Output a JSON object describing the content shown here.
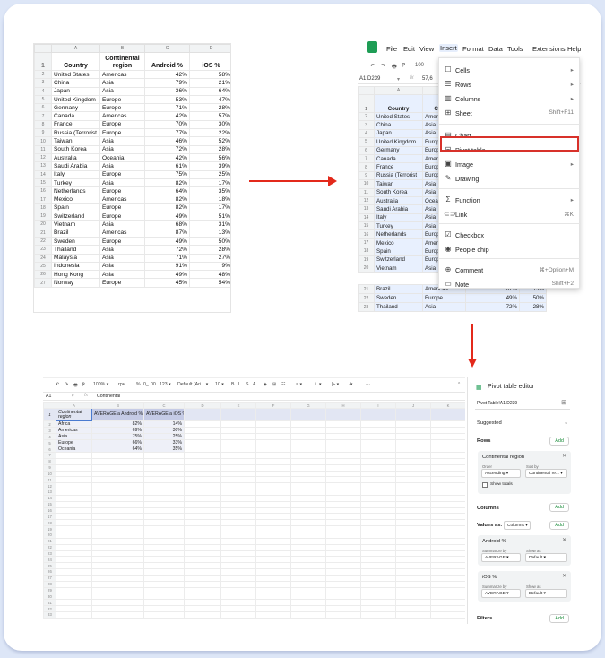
{
  "sheet1": {
    "col_letters": [
      "A",
      "B",
      "C",
      "D"
    ],
    "headers": [
      "Country",
      "Continental region",
      "Android %",
      "iOS %"
    ],
    "rows": [
      [
        "United States",
        "Americas",
        "42%",
        "58%"
      ],
      [
        "China",
        "Asia",
        "79%",
        "21%"
      ],
      [
        "Japan",
        "Asia",
        "36%",
        "64%"
      ],
      [
        "United Kingdom",
        "Europe",
        "53%",
        "47%"
      ],
      [
        "Germany",
        "Europe",
        "71%",
        "28%"
      ],
      [
        "Canada",
        "Americas",
        "42%",
        "57%"
      ],
      [
        "France",
        "Europe",
        "70%",
        "30%"
      ],
      [
        "Russia (Terrorist",
        "Europe",
        "77%",
        "22%"
      ],
      [
        "Taiwan",
        "Asia",
        "46%",
        "52%"
      ],
      [
        "South Korea",
        "Asia",
        "72%",
        "28%"
      ],
      [
        "Australia",
        "Oceania",
        "42%",
        "56%"
      ],
      [
        "Saudi Arabia",
        "Asia",
        "61%",
        "39%"
      ],
      [
        "Italy",
        "Europe",
        "75%",
        "25%"
      ],
      [
        "Turkey",
        "Asia",
        "82%",
        "17%"
      ],
      [
        "Netherlands",
        "Europe",
        "64%",
        "35%"
      ],
      [
        "Mexico",
        "Americas",
        "82%",
        "18%"
      ],
      [
        "Spain",
        "Europe",
        "82%",
        "17%"
      ],
      [
        "Switzerland",
        "Europe",
        "49%",
        "51%"
      ],
      [
        "Vietnam",
        "Asia",
        "68%",
        "31%"
      ],
      [
        "Brazil",
        "Americas",
        "87%",
        "13%"
      ],
      [
        "Sweden",
        "Europe",
        "49%",
        "50%"
      ],
      [
        "Thailand",
        "Asia",
        "72%",
        "28%"
      ],
      [
        "Malaysia",
        "Asia",
        "71%",
        "27%"
      ],
      [
        "Indonesia",
        "Asia",
        "91%",
        "9%"
      ],
      [
        "Hong Kong",
        "Asia",
        "49%",
        "48%"
      ],
      [
        "Norway",
        "Europe",
        "45%",
        "54%"
      ]
    ]
  },
  "sheet2": {
    "menubar": [
      "File",
      "Edit",
      "View",
      "Insert",
      "Format",
      "Data",
      "Tools",
      "Extensions",
      "Help"
    ],
    "active_menu": "Insert",
    "toolbar_zoom": "100",
    "cell_ref": "A1:D239",
    "formula_preview": "57,6",
    "col_letters": [
      "A",
      "B"
    ],
    "headers": [
      "Country",
      "Cont r"
    ],
    "rows": [
      [
        "United States",
        "Amer"
      ],
      [
        "China",
        "Asia"
      ],
      [
        "Japan",
        "Asia"
      ],
      [
        "United Kingdom",
        "Europ"
      ],
      [
        "Germany",
        "Europ"
      ],
      [
        "Canada",
        "Amer"
      ],
      [
        "France",
        "Europ"
      ],
      [
        "Russia (Terrorist",
        "Europ"
      ],
      [
        "Taiwan",
        "Asia"
      ],
      [
        "South Korea",
        "Asia"
      ],
      [
        "Australia",
        "Ocea"
      ],
      [
        "Saudi Arabia",
        "Asia"
      ],
      [
        "Italy",
        "Asia"
      ],
      [
        "Turkey",
        "Asia"
      ],
      [
        "Netherlands",
        "Europ"
      ],
      [
        "Mexico",
        "Amer"
      ],
      [
        "Spain",
        "Europ"
      ],
      [
        "Switzerland",
        "Europ"
      ],
      [
        "Vietnam",
        "Asia"
      ]
    ],
    "bottom_rows": [
      [
        "21",
        "Brazil",
        "Americas",
        "87%",
        "13%"
      ],
      [
        "22",
        "Sweden",
        "Europe",
        "49%",
        "50%"
      ],
      [
        "23",
        "Thailand",
        "Asia",
        "72%",
        "28%"
      ]
    ],
    "insert_menu": [
      {
        "icon": "☐",
        "label": "Cells",
        "shortcut": "▸"
      },
      {
        "icon": "☰",
        "label": "Rows",
        "shortcut": "▸"
      },
      {
        "icon": "▥",
        "label": "Columns",
        "shortcut": "▸"
      },
      {
        "icon": "⊞",
        "label": "Sheet",
        "shortcut": "Shift+F11"
      },
      {
        "icon": "▤",
        "label": "Chart",
        "shortcut": ""
      },
      {
        "icon": "⊟",
        "label": "Pivot table",
        "shortcut": ""
      },
      {
        "icon": "▣",
        "label": "Image",
        "shortcut": "▸"
      },
      {
        "icon": "✎",
        "label": "Drawing",
        "shortcut": ""
      },
      {
        "icon": "Σ",
        "label": "Function",
        "shortcut": "▸"
      },
      {
        "icon": "⊂⊃",
        "label": "Link",
        "shortcut": "⌘K"
      },
      {
        "icon": "☑",
        "label": "Checkbox",
        "shortcut": ""
      },
      {
        "icon": "◉",
        "label": "People chip",
        "shortcut": ""
      },
      {
        "icon": "⊕",
        "label": "Comment",
        "shortcut": "⌘+Option+M"
      },
      {
        "icon": "▭",
        "label": "Note",
        "shortcut": "Shift+F2"
      }
    ]
  },
  "sheet3": {
    "toolbar": [
      "↶",
      "↷",
      "🖶",
      "Ⲣ",
      "100% ▾",
      "грн.",
      "%",
      "0_",
      "00",
      "123 ▾",
      "Default (Ari... ▾",
      "10 ▾",
      "B",
      "I",
      "S",
      "A",
      "◈",
      "⊞",
      "☷",
      "≡ ▾",
      "⊥ ▾",
      "|÷ ▾",
      "⁄▾",
      "⋯"
    ],
    "cell_ref": "A1",
    "formula": "Continental",
    "col_letters": [
      "A",
      "B",
      "C",
      "D",
      "E",
      "F",
      "G",
      "H",
      "I",
      "J",
      "K"
    ],
    "pivot_headers": [
      "Continental region",
      "AVERAGE a Android %",
      "AVERAGE a iOS %"
    ],
    "pivot_rows": [
      [
        "Africa",
        "82%",
        "14%"
      ],
      [
        "Americas",
        "69%",
        "30%"
      ],
      [
        "Asia",
        "75%",
        "25%"
      ],
      [
        "Europe",
        "66%",
        "33%"
      ],
      [
        "Oceania",
        "64%",
        "35%"
      ]
    ],
    "row_count": 33
  },
  "editor": {
    "title": "Pivot table editor",
    "range": "Pivot Table!A1:D239",
    "suggested": "Suggested",
    "rows_label": "Rows",
    "add": "Add",
    "row_field": "Continental region",
    "order_label": "Order",
    "order_value": "Ascending",
    "sortby_label": "Sort by",
    "sortby_value": "Continental re...",
    "show_totals": "Show totals",
    "columns_label": "Columns",
    "values_as_label": "Values as:",
    "values_as_value": "Columns",
    "values_label": "Values",
    "value_fields": [
      {
        "name": "Android %",
        "summarize_label": "Summarize by",
        "summarize": "AVERAGE",
        "show_label": "Show as",
        "show": "Default"
      },
      {
        "name": "iOS %",
        "summarize_label": "Summarize by",
        "summarize": "AVERAGE",
        "show_label": "Show as",
        "show": "Default"
      }
    ],
    "filters_label": "Filters"
  },
  "colors": {
    "accent": "#e3291b",
    "sheets_green": "#1e9d55",
    "pivot_header": "#c5cbe6"
  }
}
